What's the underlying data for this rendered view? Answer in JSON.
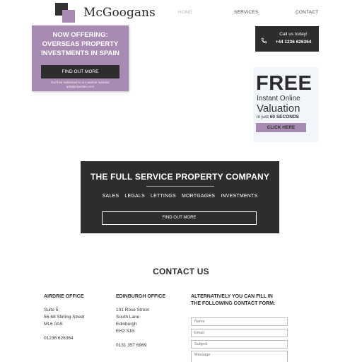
{
  "brand": {
    "name": "McGoogans"
  },
  "nav": {
    "home": "HOME",
    "services": "SERVICES",
    "contact": "CONTACT"
  },
  "promo": {
    "title": "NOW OFFERING: OVERSEAS PROPERTY INVESTMENTS IN SPAIN",
    "button": "FIND OUT MORE",
    "note": "You'll be redirected to our partner website: qsbdproperties.com"
  },
  "call": {
    "label": "Call us today!",
    "number": "+44 1236 626364"
  },
  "valuation": {
    "free": "FREE",
    "instant": "Instant Online",
    "valuation": "Valuation",
    "time_prefix": "in just",
    "time_bold": "60 SECONDS",
    "button": "CLICK HERE"
  },
  "hero": {
    "title": "THE FULL SERVICE PROPERTY COMPANY",
    "services": [
      "SALES",
      "LEGALS",
      "LETTINGS",
      "MORTGAGES",
      "INVESTMENTS"
    ],
    "button": "FIND OUT MORE"
  },
  "contact": {
    "title": "CONTACT US",
    "airdrie": {
      "title": "AIRDRIE OFFICE",
      "line1": "Suite 5,",
      "line2": "56-68 Stirling Street",
      "line3": "ML6 0AS",
      "phone": "01236 626364"
    },
    "edinburgh": {
      "title": "EDINBURGH OFFICE",
      "line1": "101 Rose Street",
      "line2": "South Lane",
      "line3": "Edinburgh",
      "line4": "EH2 3JG",
      "phone": "0131 357 6969"
    },
    "form": {
      "intro": "ALTERNATIVELY YOU CAN FILL IN THE FOLLOWING CONTACT FORM:",
      "name_placeholder": "Name",
      "email_placeholder": "Email",
      "subject_placeholder": "Subject",
      "message_placeholder": "Message"
    }
  },
  "colors": {
    "accent": "#a78bb3",
    "dark": "#2d2d2d"
  }
}
